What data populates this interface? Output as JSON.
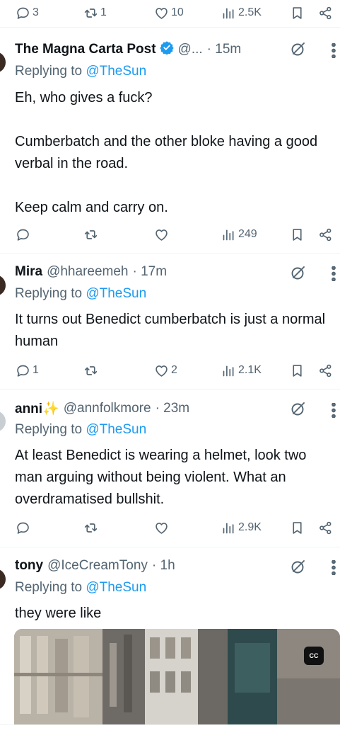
{
  "top_actions": {
    "replies": "3",
    "reposts": "1",
    "likes": "10",
    "views": "2.5K"
  },
  "tweets": [
    {
      "name": "The Magna Carta Post",
      "handle": "@...",
      "time": "· 15m",
      "verified": true,
      "replying_prefix": "Replying to",
      "replying_to": "@TheSun",
      "text": "Eh, who gives a fuck?\n\nCumberbatch and the other bloke having a good verbal in the road.\n\nKeep calm and carry on.",
      "replies": "",
      "reposts": "",
      "likes": "",
      "views": "249"
    },
    {
      "name": "Mira",
      "handle": "@hhareemeh",
      "time": "· 17m",
      "verified": false,
      "replying_prefix": "Replying to",
      "replying_to": "@TheSun",
      "text": "It turns out Benedict cumberbatch is just a normal human",
      "replies": "1",
      "reposts": "",
      "likes": "2",
      "views": "2.1K"
    },
    {
      "name": "anni✨",
      "handle": "@annfolkmore",
      "time": "· 23m",
      "verified": false,
      "replying_prefix": "Replying to",
      "replying_to": "@TheSun",
      "text": "At least Benedict is wearing a helmet, look two man arguing without being violent. What an overdramatised bullshit.",
      "replies": "",
      "reposts": "",
      "likes": "",
      "views": "2.9K"
    },
    {
      "name": "tony",
      "handle": "@IceCreamTony",
      "time": "· 1h",
      "verified": false,
      "replying_prefix": "Replying to",
      "replying_to": "@TheSun",
      "text": "they were like",
      "media_badge": "CC"
    }
  ],
  "icons": {
    "reply": "reply-icon",
    "repost": "repost-icon",
    "like": "heart-icon",
    "views": "views-icon",
    "bookmark": "bookmark-icon",
    "share": "share-icon",
    "grok": "grok-icon",
    "more": "more-icon",
    "verified": "verified-badge-icon"
  },
  "colors": {
    "text": "#0f1419",
    "secondary": "#536471",
    "link": "#1d9bf0",
    "border": "#eff3f4"
  }
}
